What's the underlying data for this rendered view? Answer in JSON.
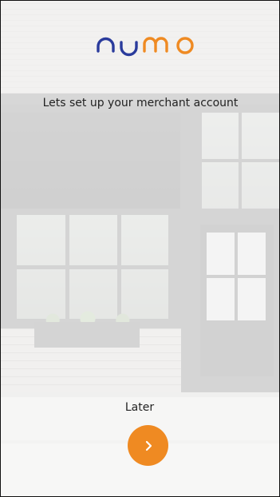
{
  "brand": {
    "logo_text": "numo",
    "colors": {
      "primary_blue": "#2a3b9c",
      "accent_orange": "#ef8a22"
    }
  },
  "onboarding": {
    "headline": "Lets set up your merchant account",
    "later_label": "Later"
  },
  "icons": {
    "next": "chevron-right-icon"
  }
}
